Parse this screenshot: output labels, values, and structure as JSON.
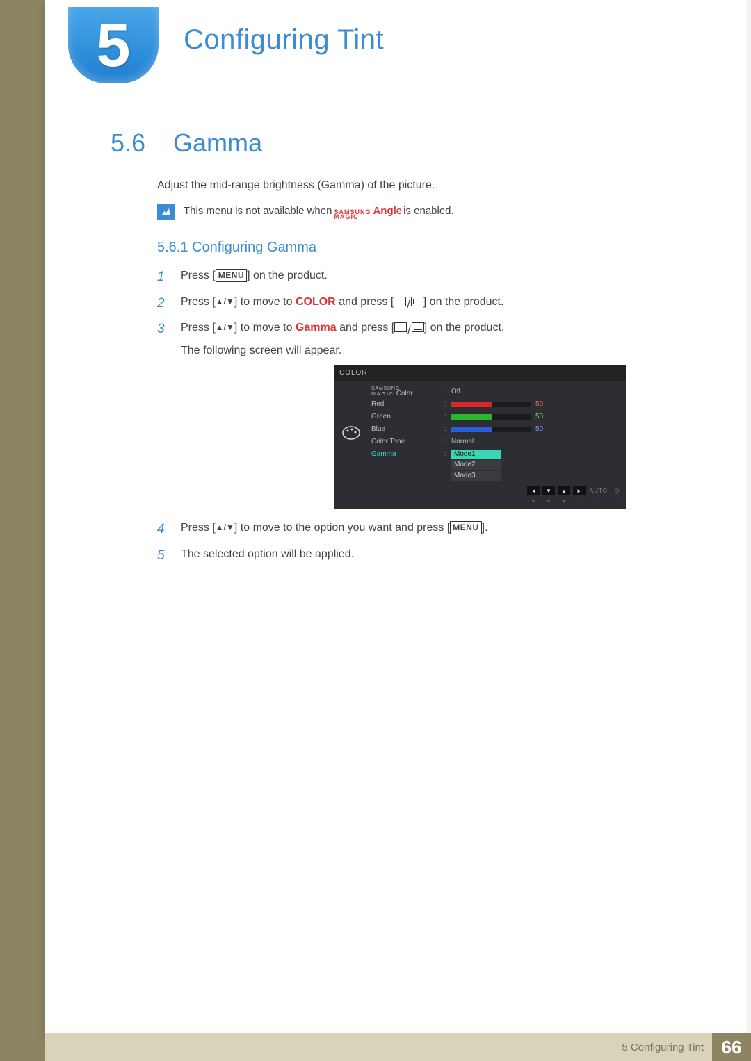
{
  "chapter": {
    "num": "5",
    "title": "Configuring Tint"
  },
  "section": {
    "num": "5.6",
    "title": "Gamma"
  },
  "intro": "Adjust the mid-range brightness (Gamma) of the picture.",
  "note": {
    "pre": "This menu is not available when ",
    "samsung": "SAMSUNG",
    "magic": "MAGIC",
    "angle": "Angle",
    "post": " is enabled."
  },
  "subsection": "5.6.1  Configuring Gamma",
  "steps": {
    "s1": {
      "n": "1",
      "a": "Press [",
      "menu": "MENU",
      "b": "] on the product."
    },
    "s2": {
      "n": "2",
      "a": "Press [",
      "arrows": "▲/▼",
      "b": "] to move to ",
      "kw": "COLOR",
      "c": " and press [",
      "d": "] on the product."
    },
    "s3": {
      "n": "3",
      "a": "Press [",
      "arrows": "▲/▼",
      "b": "] to move to ",
      "kw": "Gamma",
      "c": " and press [",
      "d": "] on the product.",
      "follow": "The following screen will appear."
    },
    "s4": {
      "n": "4",
      "a": "Press [",
      "arrows": "▲/▼",
      "b": "] to move to the option you want and press [",
      "menu": "MENU",
      "c": "]."
    },
    "s5": {
      "n": "5",
      "a": "The selected option will be applied."
    }
  },
  "osd": {
    "title": "COLOR",
    "magic_small1": "SAMSUNG",
    "magic_small2": "MAGIC",
    "magic_label_suffix": " Color",
    "rows": {
      "magic_val": "Off",
      "red": {
        "label": "Red",
        "value": 50
      },
      "green": {
        "label": "Green",
        "value": 50
      },
      "blue": {
        "label": "Blue",
        "value": 50
      },
      "tone": {
        "label": "Color Tone",
        "value": "Normal"
      },
      "gamma": {
        "label": "Gamma",
        "selected": "Mode1",
        "opts": [
          "Mode2",
          "Mode3"
        ]
      }
    },
    "footer": {
      "auto": "AUTO"
    }
  },
  "footer": {
    "text": "5 Configuring Tint",
    "page": "66"
  },
  "chart_data": {
    "type": "bar",
    "title": "COLOR settings (RGB sliders)",
    "categories": [
      "Red",
      "Green",
      "Blue"
    ],
    "values": [
      50,
      50,
      50
    ],
    "ylim": [
      0,
      100
    ]
  }
}
